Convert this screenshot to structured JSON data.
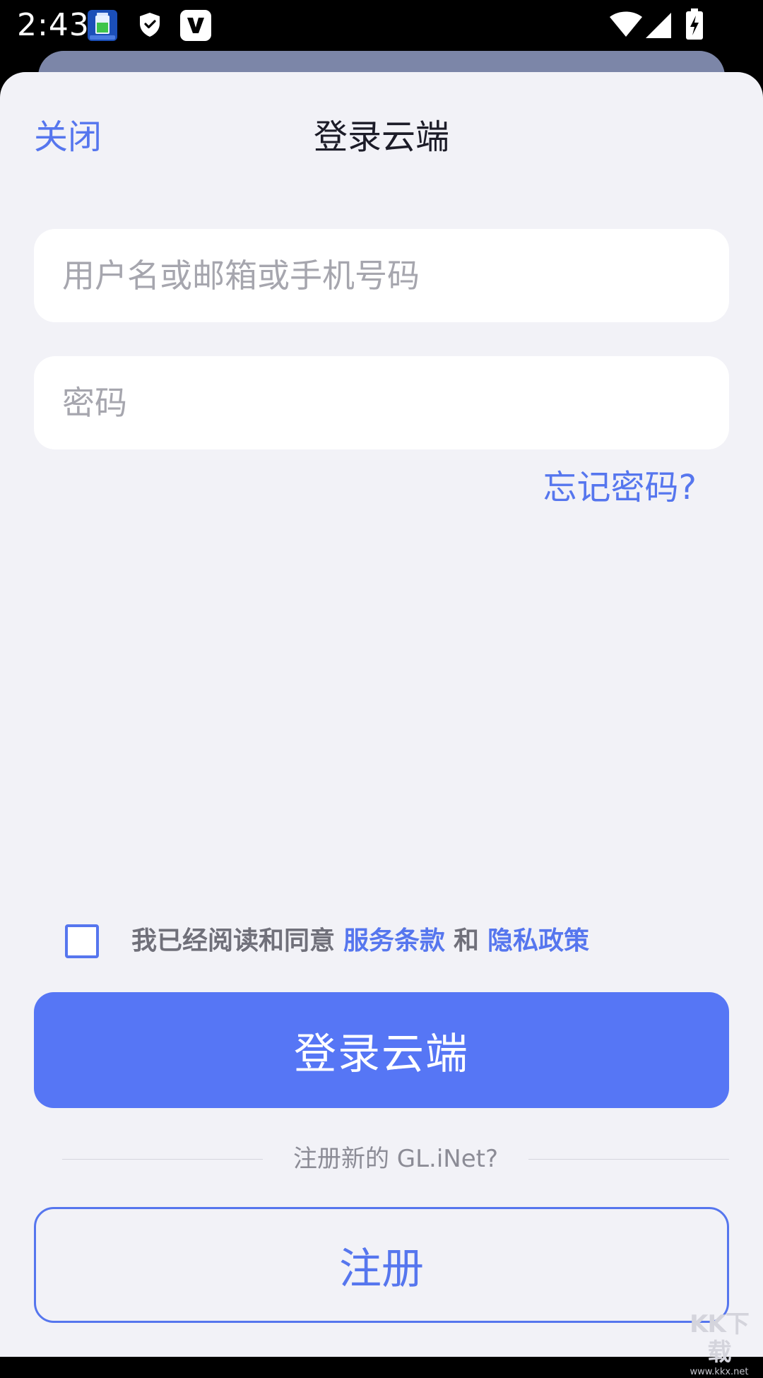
{
  "status_bar": {
    "time": "2:43",
    "icons": [
      "battery-app-icon",
      "shield-icon",
      "v-app-icon",
      "wifi-icon",
      "cell-signal-icon",
      "battery-charging-icon"
    ]
  },
  "header": {
    "close_label": "关闭",
    "title": "登录云端"
  },
  "form": {
    "username_placeholder": "用户名或邮箱或手机号码",
    "username_value": "",
    "password_placeholder": "密码",
    "password_value": "",
    "forgot_label": "忘记密码?"
  },
  "agreement": {
    "checked": false,
    "prefix": "我已经阅读和同意",
    "terms_label": "服务条款",
    "conjunction": "和",
    "privacy_label": "隐私政策"
  },
  "actions": {
    "login_label": "登录云端",
    "register_prompt": "注册新的 GL.iNet?",
    "register_label": "注册"
  },
  "watermark": {
    "mark": "KK下载",
    "url": "www.kkx.net"
  },
  "colors": {
    "accent": "#5676F5",
    "sheet_background": "#F2F2F7",
    "text_muted": "#70707A"
  }
}
